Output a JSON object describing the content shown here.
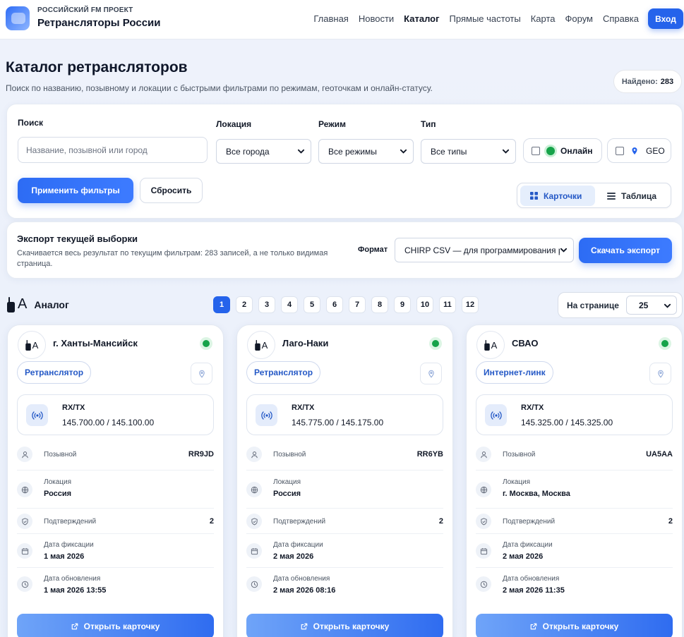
{
  "header": {
    "kicker": "РОССИЙСКИЙ FM ПРОЕКТ",
    "title": "Ретрансляторы России",
    "nav": [
      "Главная",
      "Новости",
      "Каталог",
      "Прямые частоты",
      "Карта",
      "Форум",
      "Справка"
    ],
    "active_nav": "Каталог",
    "login": "Вход"
  },
  "page": {
    "title": "Каталог ретрансляторов",
    "subtitle": "Поиск по названию, позывному и локации с быстрыми фильтрами по режимам, геоточкам и онлайн-статусу.",
    "found_label": "Найдено:",
    "found_count": "283"
  },
  "filters": {
    "search_label": "Поиск",
    "search_placeholder": "Название, позывной или город",
    "location_label": "Локация",
    "location_value": "Все города",
    "mode_label": "Режим",
    "mode_value": "Все режимы",
    "type_label": "Тип",
    "type_value": "Все типы",
    "online_label": "Онлайн",
    "geo_label": "GEO",
    "apply": "Применить фильтры",
    "reset": "Сбросить",
    "view_cards": "Карточки",
    "view_table": "Таблица"
  },
  "export": {
    "title": "Экспорт текущей выборки",
    "description": "Скачивается весь результат по текущим фильтрам: 283 записей, а не только видимая страница.",
    "format_label": "Формат",
    "format_value": "CHIRP CSV — для программирования рации",
    "button": "Скачать экспорт"
  },
  "section": {
    "glyph": "A",
    "title": "Аналог",
    "pages": [
      "1",
      "2",
      "3",
      "4",
      "5",
      "6",
      "7",
      "8",
      "9",
      "10",
      "11",
      "12"
    ],
    "current_page": "1",
    "per_page_label": "На странице",
    "per_page_value": "25"
  },
  "labels": {
    "rxtx": "RX/TX",
    "callsign": "Позывной",
    "location": "Локация",
    "confirmations": "Подтверждений",
    "fixed_date": "Дата фиксации",
    "updated_date": "Дата обновления",
    "open_card": "Открыть карточку",
    "avatar_glyph": "A"
  },
  "colors": {
    "accent": "#2563eb",
    "online": "#16a34a",
    "chip_text": "#2559c6"
  },
  "cards": [
    {
      "title": "г. Ханты-Мансийск",
      "type": "Ретранслятор",
      "freq": "145.700.00 / 145.100.00",
      "callsign": "RR9JD",
      "location": "Россия",
      "confirmations": "2",
      "fixed": "1 мая 2026",
      "updated": "1 мая 2026 13:55",
      "online": true
    },
    {
      "title": "Лаго-Наки",
      "type": "Ретранслятор",
      "freq": "145.775.00 / 145.175.00",
      "callsign": "RR6YB",
      "location": "Россия",
      "confirmations": "2",
      "fixed": "2 мая 2026",
      "updated": "2 мая 2026 08:16",
      "online": true
    },
    {
      "title": "СВАО",
      "type": "Интернет-линк",
      "freq": "145.325.00 / 145.325.00",
      "callsign": "UA5AA",
      "location": "г. Москва, Москва",
      "confirmations": "2",
      "fixed": "2 мая 2026",
      "updated": "2 мая 2026 11:35",
      "online": true
    }
  ]
}
